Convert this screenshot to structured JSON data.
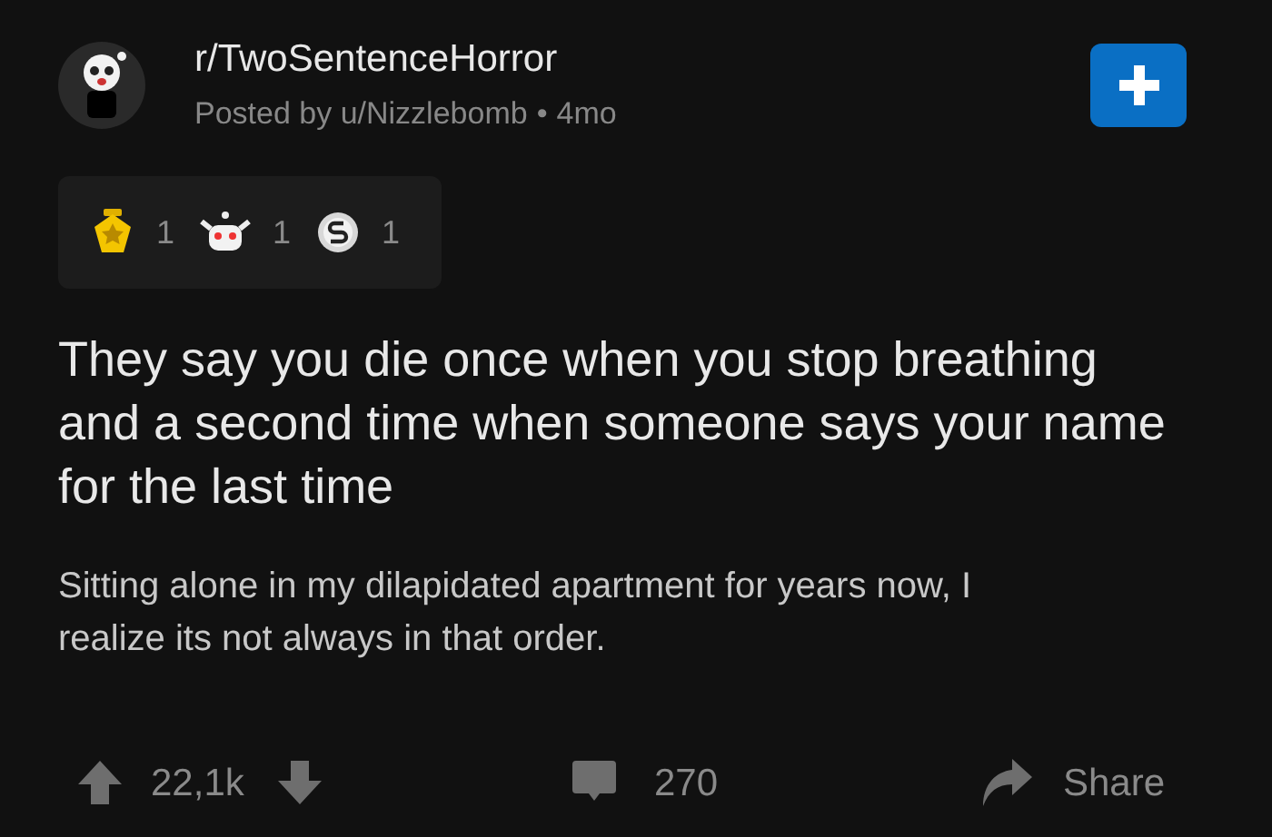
{
  "post": {
    "subreddit": "r/TwoSentenceHorror",
    "byline": "Posted by u/Nizzlebomb",
    "separator": "•",
    "age": "4mo",
    "awards": [
      {
        "kind": "star",
        "count": "1"
      },
      {
        "kind": "bot",
        "count": "1"
      },
      {
        "kind": "silver",
        "count": "1"
      }
    ],
    "title": "They say you die once when you stop breathing and a second time when someone says your name for the last time",
    "body": "Sitting alone in my dilapidated apartment for years now, I realize its not always in that order.",
    "votes": "22,1k",
    "comments": "270",
    "share": "Share"
  }
}
